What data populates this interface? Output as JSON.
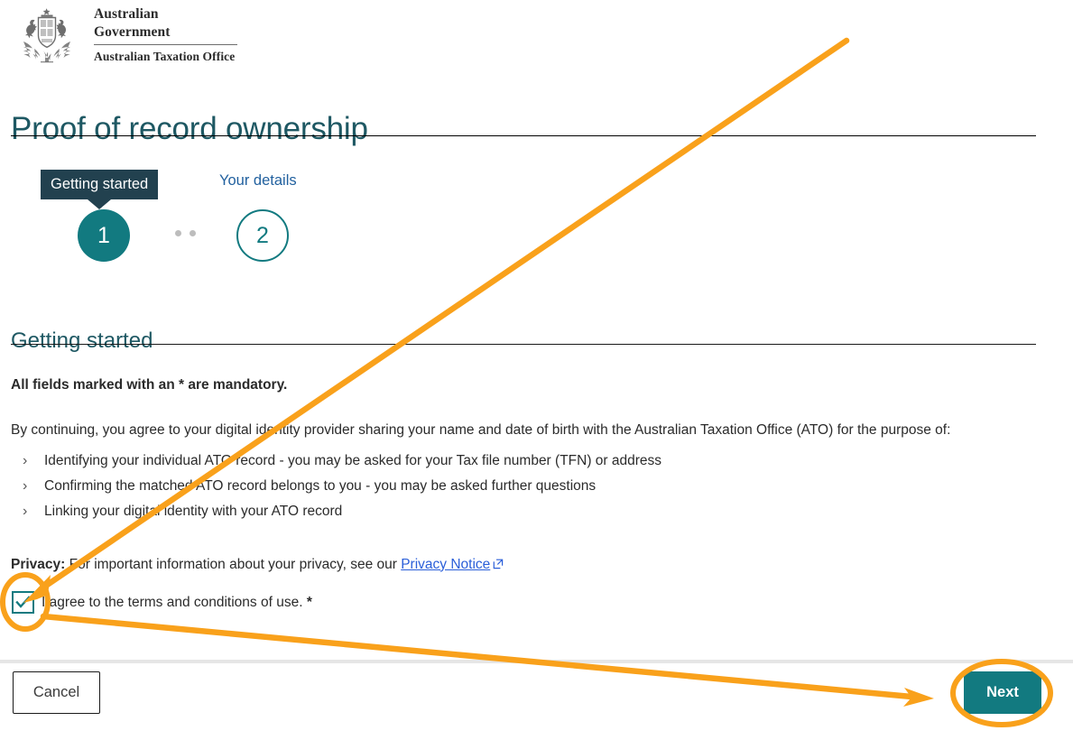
{
  "brand": {
    "coat_of_arms_icon": "commonwealth-coat-of-arms",
    "line1": "Australian Government",
    "line2": "Australian Taxation Office"
  },
  "header": {
    "title": "Proof of record ownership"
  },
  "stepper": {
    "steps": [
      {
        "number": "1",
        "label": "Getting started",
        "state": "active"
      },
      {
        "number": "2",
        "label": "Your details",
        "state": "inactive"
      }
    ]
  },
  "section": {
    "title": "Getting started",
    "mandatory_note": "All fields marked with an * are mandatory.",
    "intro": "By continuing, you agree to your digital identity provider sharing your name and date of birth with the Australian Taxation Office (ATO) for the purpose of:",
    "bullets": [
      "Identifying your individual ATO record - you may be asked for your Tax file number (TFN) or address",
      "Confirming the matched ATO record belongs to you - you may be asked further questions",
      "Linking your digital identity with your ATO record"
    ],
    "privacy_label": "Privacy:",
    "privacy_text": " For important information about your privacy, see our ",
    "privacy_link": "Privacy Notice",
    "privacy_link_icon": "external-link-icon"
  },
  "agreement": {
    "checkbox_icon": "checkmark-icon",
    "checked": "true",
    "label": "I agree to the terms and conditions of use.",
    "required_marker": "*"
  },
  "footer": {
    "cancel_label": "Cancel",
    "next_label": "Next"
  },
  "annotations": {
    "arrow_color": "#f9a11b",
    "highlight_checkbox": "ellipse-around-agree-checkbox",
    "highlight_next": "ellipse-around-next-button"
  },
  "colors": {
    "teal": "#127a80",
    "dark_teal_heading": "#1e5863",
    "tooltip_navy": "#22414f",
    "step_link_blue": "#22619f",
    "link_blue": "#2b5fd9",
    "annotation_orange": "#f9a11b",
    "divider_gray": "#e6e6e6"
  }
}
